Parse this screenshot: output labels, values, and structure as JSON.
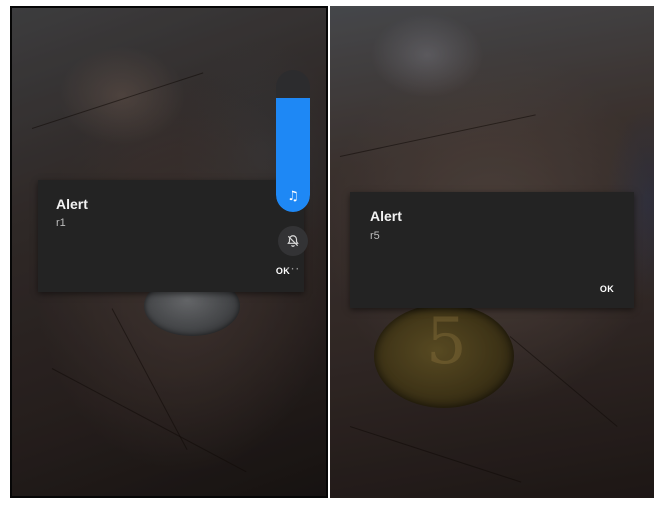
{
  "screens": [
    {
      "dialog": {
        "title": "Alert",
        "message": "r1",
        "ok_label": "OK"
      },
      "volume": {
        "level": 0.8,
        "stream_icon": "music-note-icon",
        "ringer_icon": "bell-off-icon",
        "more_icon": "more-horizontal-icon",
        "more_glyph": "···",
        "accent": "#1e88f5"
      }
    },
    {
      "dialog": {
        "title": "Alert",
        "message": "r5",
        "ok_label": "OK"
      }
    }
  ],
  "coin_numeral": "5"
}
